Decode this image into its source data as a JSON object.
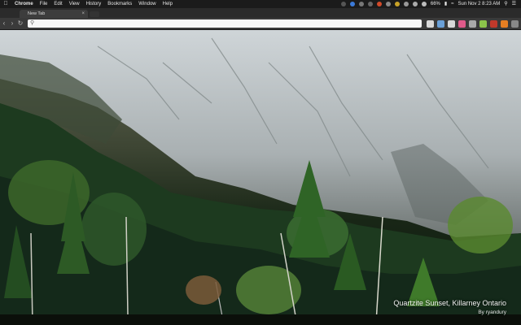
{
  "menubar": {
    "app": "Chrome",
    "items": [
      "File",
      "Edit",
      "View",
      "History",
      "Bookmarks",
      "Window",
      "Help"
    ],
    "battery": "66%",
    "datetime": "Sun Nov 2  8:23 AM"
  },
  "tabs": [
    {
      "label": "New Tab"
    }
  ],
  "omnibox": {
    "value": ""
  },
  "wallpaper": {
    "title": "Quartzite Sunset, Killarney Ontario",
    "credit": "By ryandury"
  },
  "icons": {
    "apple": "apple-icon",
    "wifi": "wifi-icon",
    "search": "spotlight-icon",
    "list": "notification-center-icon"
  },
  "colors": {
    "menubar": "#1b1b1b",
    "toolbar": "#3a3a3a",
    "omnibox": "#f7f7f7",
    "rock": "#c9cfd2",
    "forest": "#1d3a1f"
  }
}
